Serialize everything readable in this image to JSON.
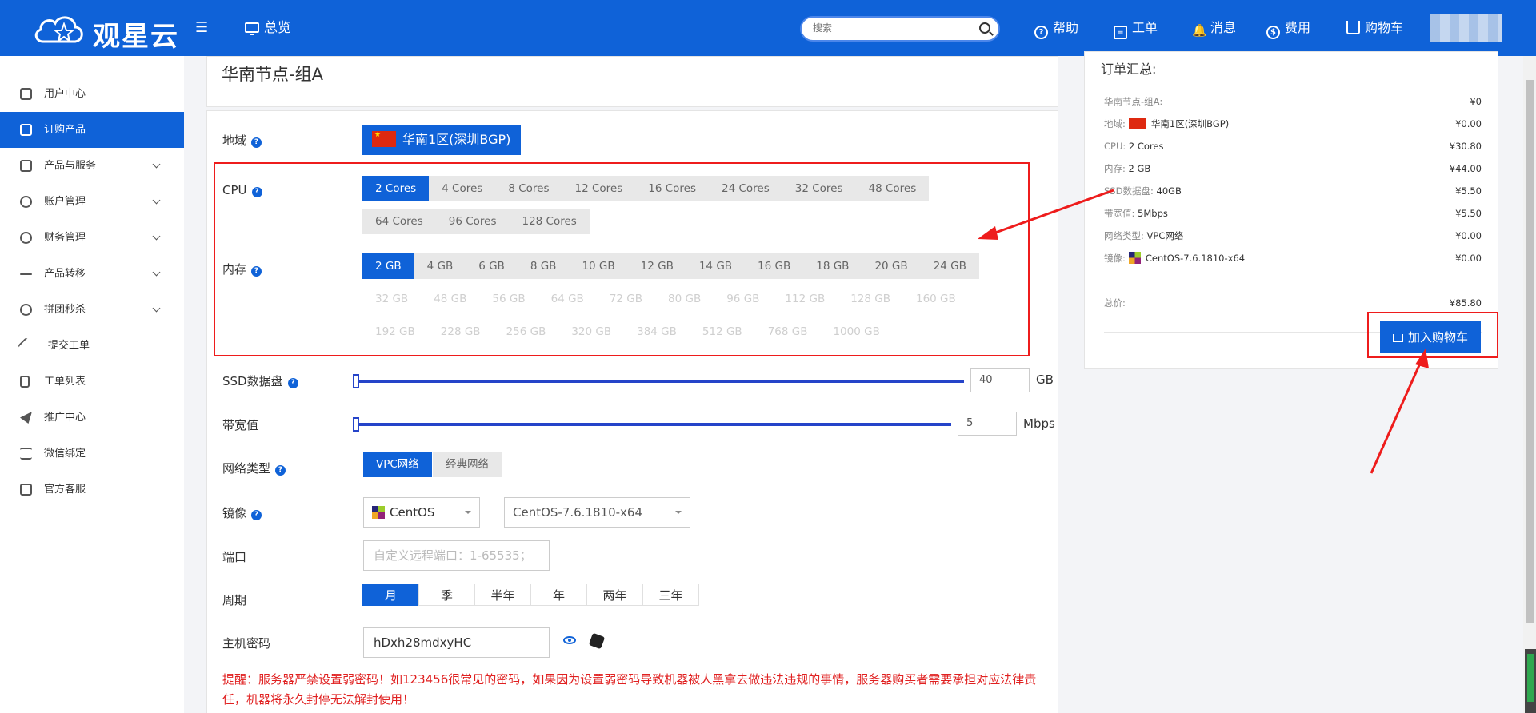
{
  "header": {
    "logo_text": "观星云",
    "overview": "总览",
    "search_placeholder": "搜索",
    "nav": {
      "help": "帮助",
      "ticket": "工单",
      "message": "消息",
      "fee": "费用",
      "cart": "购物车"
    }
  },
  "sidebar": {
    "items": [
      {
        "label": "用户中心",
        "icon": "home-icon"
      },
      {
        "label": "订购产品",
        "icon": "cart-icon"
      },
      {
        "label": "产品与服务",
        "icon": "grid-icon"
      },
      {
        "label": "账户管理",
        "icon": "user-icon"
      },
      {
        "label": "财务管理",
        "icon": "dollar-icon"
      },
      {
        "label": "产品转移",
        "icon": "transfer-icon"
      },
      {
        "label": "拼团秒杀",
        "icon": "target-icon"
      },
      {
        "label": "提交工单",
        "icon": "wrench-icon"
      },
      {
        "label": "工单列表",
        "icon": "file-icon"
      },
      {
        "label": "推广中心",
        "icon": "send-icon"
      },
      {
        "label": "微信绑定",
        "icon": "sliders-icon"
      },
      {
        "label": "官方客服",
        "icon": "chat-icon"
      }
    ]
  },
  "page": {
    "title": "华南节点-组A"
  },
  "form": {
    "region_label": "地域",
    "region_value": "华南1区(深圳BGP)",
    "cpu_label": "CPU",
    "cpu_options": [
      "2 Cores",
      "4 Cores",
      "8 Cores",
      "12 Cores",
      "16 Cores",
      "24 Cores",
      "32 Cores",
      "48 Cores",
      "64 Cores",
      "96 Cores",
      "128 Cores"
    ],
    "memory_label": "内存",
    "memory_options": [
      "2 GB",
      "4 GB",
      "6 GB",
      "8 GB",
      "10 GB",
      "12 GB",
      "14 GB",
      "16 GB",
      "18 GB",
      "20 GB",
      "24 GB",
      "32 GB",
      "48 GB",
      "56 GB",
      "64 GB",
      "72 GB",
      "80 GB",
      "96 GB",
      "112 GB",
      "128 GB",
      "160 GB",
      "192 GB",
      "228 GB",
      "256 GB",
      "320 GB",
      "384 GB",
      "512 GB",
      "768 GB",
      "1000 GB"
    ],
    "ssd_label": "SSD数据盘",
    "ssd_value": "40",
    "ssd_unit": "GB",
    "bandwidth_label": "带宽值",
    "bandwidth_value": "5",
    "bandwidth_unit": "Mbps",
    "network_label": "网络类型",
    "network_options": [
      "VPC网络",
      "经典网络"
    ],
    "image_label": "镜像",
    "image_os": "CentOS",
    "image_version": "CentOS-7.6.1810-x64",
    "port_label": "端口",
    "port_placeholder": "自定义远程端口：1-65535；",
    "period_label": "周期",
    "period_options": [
      "月",
      "季",
      "半年",
      "年",
      "两年",
      "三年"
    ],
    "password_label": "主机密码",
    "password_value": "hDxh28mdxyHC",
    "warning": "提醒：服务器严禁设置弱密码！如123456很常见的密码，如果因为设置弱密码导致机器被人黑拿去做违法违规的事情，服务器购买者需要承担对应法律责任，机器将永久封停无法解封使用！"
  },
  "summary": {
    "title": "订单汇总:",
    "rows": [
      {
        "label": "华南节点-组A:",
        "value": "",
        "price": "¥0"
      },
      {
        "label": "地域:",
        "value": "华南1区(深圳BGP)",
        "price": "¥0.00"
      },
      {
        "label": "CPU:",
        "value": "2 Cores",
        "price": "¥30.80"
      },
      {
        "label": "内存:",
        "value": "2 GB",
        "price": "¥44.00"
      },
      {
        "label": "SSD数据盘:",
        "value": "40GB",
        "price": "¥5.50"
      },
      {
        "label": "带宽值:",
        "value": "5Mbps",
        "price": "¥5.50"
      },
      {
        "label": "网络类型:",
        "value": "VPC网络",
        "price": "¥0.00"
      },
      {
        "label": "镜像:",
        "value": "CentOS-7.6.1810-x64",
        "price": "¥0.00"
      }
    ],
    "total_label": "总价:",
    "total_price": "¥85.80",
    "cart_button": "加入购物车"
  },
  "colors": {
    "primary": "#0f62d8",
    "annotation_red": "#ee1c1c",
    "warning_text": "#e02020"
  }
}
